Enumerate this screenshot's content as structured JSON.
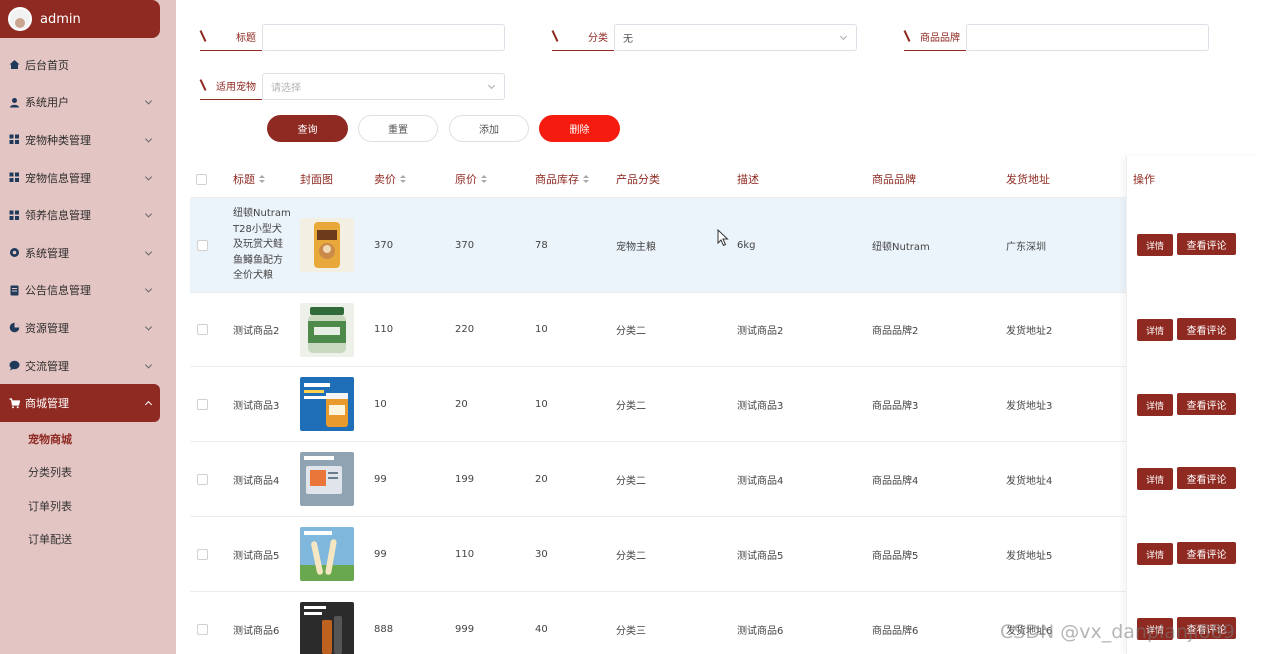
{
  "user": {
    "name": "admin"
  },
  "menu": [
    {
      "label": "后台首页",
      "icon": "home-icon"
    },
    {
      "label": "系统用户",
      "icon": "user-icon"
    },
    {
      "label": "宠物种类管理",
      "icon": "grid-icon"
    },
    {
      "label": "宠物信息管理",
      "icon": "grid-icon"
    },
    {
      "label": "领养信息管理",
      "icon": "grid-icon"
    },
    {
      "label": "系统管理",
      "icon": "gear-icon"
    },
    {
      "label": "公告信息管理",
      "icon": "document-icon"
    },
    {
      "label": "资源管理",
      "icon": "pie-icon"
    },
    {
      "label": "交流管理",
      "icon": "chat-icon"
    },
    {
      "label": "商城管理",
      "icon": "cart-icon"
    }
  ],
  "submenu": [
    "宠物商城",
    "分类列表",
    "订单列表",
    "订单配送"
  ],
  "filters": {
    "title_label": "标题",
    "title_value": "",
    "category_label": "分类",
    "category_value": "无",
    "brand_label": "商品品牌",
    "brand_value": "",
    "pet_label": "适用宠物",
    "pet_placeholder": "请选择"
  },
  "buttons": {
    "query": "查询",
    "reset": "重置",
    "add": "添加",
    "delete": "删除"
  },
  "table": {
    "headers": {
      "title": "标题",
      "cover": "封面图",
      "price": "卖价",
      "original": "原价",
      "stock": "商品库存",
      "category": "产品分类",
      "desc": "描述",
      "brand": "商品品牌",
      "address": "发货地址",
      "ops": "操作"
    },
    "rows": [
      {
        "title": "纽顿Nutram T28小型犬及玩赏犬鲑鱼鳟鱼配方全价犬粮",
        "price": "370",
        "original": "370",
        "stock": "78",
        "category": "宠物主粮",
        "desc": "6kg",
        "brand": "纽顿Nutram",
        "address": "广东深圳"
      },
      {
        "title": "测试商品2",
        "price": "110",
        "original": "220",
        "stock": "10",
        "category": "分类二",
        "desc": "测试商品2",
        "brand": "商品品牌2",
        "address": "发货地址2"
      },
      {
        "title": "测试商品3",
        "price": "10",
        "original": "20",
        "stock": "10",
        "category": "分类二",
        "desc": "测试商品3",
        "brand": "商品品牌3",
        "address": "发货地址3"
      },
      {
        "title": "测试商品4",
        "price": "99",
        "original": "199",
        "stock": "20",
        "category": "分类二",
        "desc": "测试商品4",
        "brand": "商品品牌4",
        "address": "发货地址4"
      },
      {
        "title": "测试商品5",
        "price": "99",
        "original": "110",
        "stock": "30",
        "category": "分类二",
        "desc": "测试商品5",
        "brand": "商品品牌5",
        "address": "发货地址5"
      },
      {
        "title": "测试商品6",
        "price": "888",
        "original": "999",
        "stock": "40",
        "category": "分类三",
        "desc": "测试商品6",
        "brand": "商品品牌6",
        "address": "发货地址6"
      }
    ],
    "row_buttons": {
      "detail": "详情",
      "review": "查看评论"
    }
  },
  "watermark": "CSDN @vx_danpianji889",
  "colors": {
    "primary": "#8f2a22",
    "sidebar": "#e3c5c3",
    "danger": "#f51b0e"
  }
}
